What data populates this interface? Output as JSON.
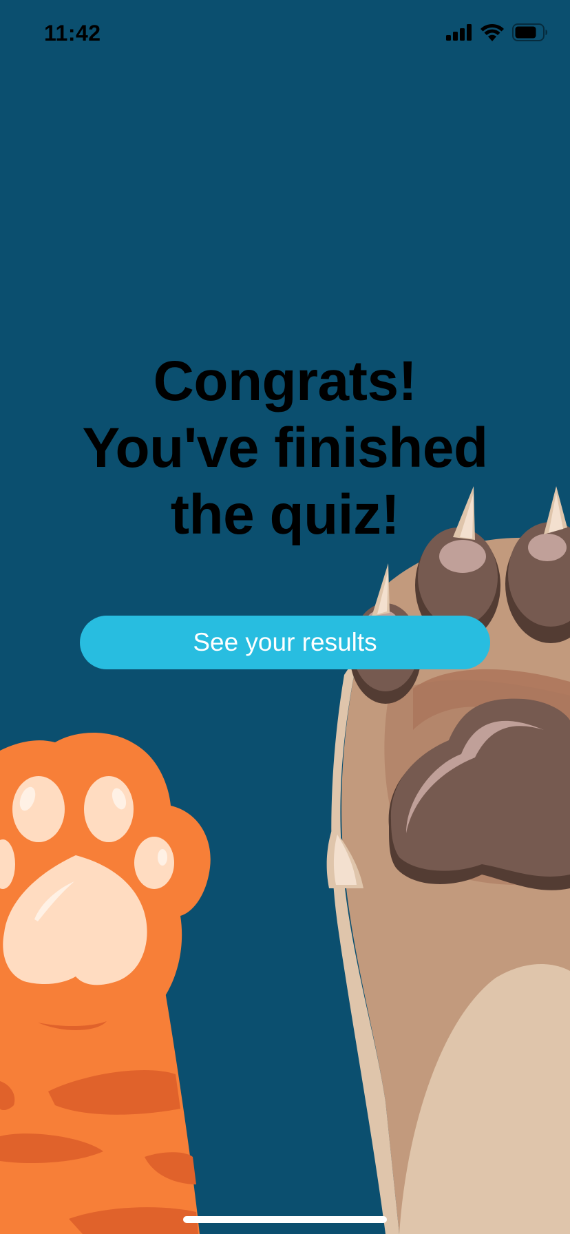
{
  "status_bar": {
    "time": "11:42",
    "icons": [
      "signal-icon",
      "wifi-icon",
      "battery-icon"
    ]
  },
  "headline": {
    "line1": "Congrats!",
    "line2": "You've finished",
    "line3": "the quiz!"
  },
  "results_button": {
    "label": "See your results"
  },
  "colors": {
    "background": "#0b4f6f",
    "button": "#28bde0",
    "button_text": "#ffffff",
    "headline": "#000000",
    "orange_paw": "#f77f38",
    "orange_pad": "#ffdcc1",
    "brown_paw": "#c29a7d",
    "brown_pad": "#765a50",
    "cream_fur": "#dfc5ab"
  },
  "illustrations": [
    "orange-cat-paw",
    "brown-cat-paw"
  ]
}
